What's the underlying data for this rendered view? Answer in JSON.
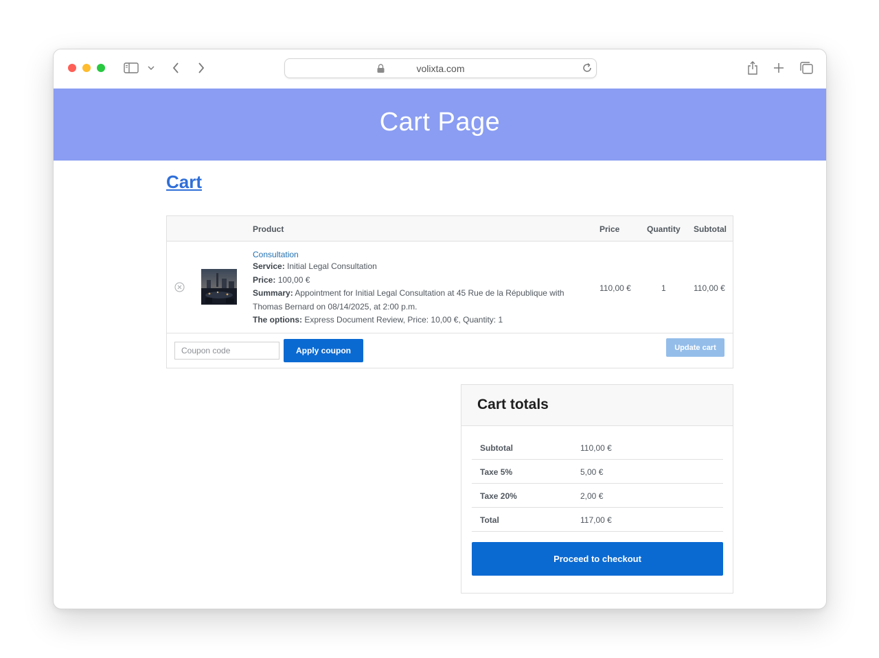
{
  "browser": {
    "url": "volixta.com",
    "icons": [
      "sidebar-icon",
      "chevron-down-icon",
      "back-arrow-icon",
      "forward-arrow-icon",
      "lock-icon",
      "reload-icon",
      "share-icon",
      "plus-icon",
      "tabs-icon"
    ]
  },
  "banner": {
    "title": "Cart Page",
    "color": "#8a9df2"
  },
  "cart": {
    "heading": "Cart",
    "columns": {
      "product": "Product",
      "price": "Price",
      "quantity": "Quantity",
      "subtotal": "Subtotal"
    },
    "item": {
      "name": "Consultation",
      "service_label": "Service:",
      "service": "Initial Legal Consultation",
      "price_label": "Price:",
      "price_text": "100,00 €",
      "summary_label": "Summary:",
      "summary": "Appointment for Initial Legal Consultation at 45 Rue de la République with Thomas Bernard on 08/14/2025, at 2:00 p.m.",
      "options_label": "The options:",
      "options": "Express Document Review, Price: 10,00 €, Quantity: 1",
      "price": "110,00 €",
      "quantity": "1",
      "subtotal": "110,00 €"
    },
    "coupon": {
      "placeholder": "Coupon code",
      "apply_label": "Apply coupon"
    },
    "update_label": "Update cart"
  },
  "totals": {
    "title": "Cart totals",
    "rows": [
      {
        "label": "Subtotal",
        "value": "110,00 €"
      },
      {
        "label": "Taxe 5%",
        "value": "5,00 €"
      },
      {
        "label": "Taxe 20%",
        "value": "2,00 €"
      },
      {
        "label": "Total",
        "value": "117,00 €"
      }
    ],
    "checkout_label": "Proceed to checkout"
  },
  "colors": {
    "accent": "#0b6ad2",
    "link": "#2271b1",
    "update_button": "#94bde9"
  }
}
